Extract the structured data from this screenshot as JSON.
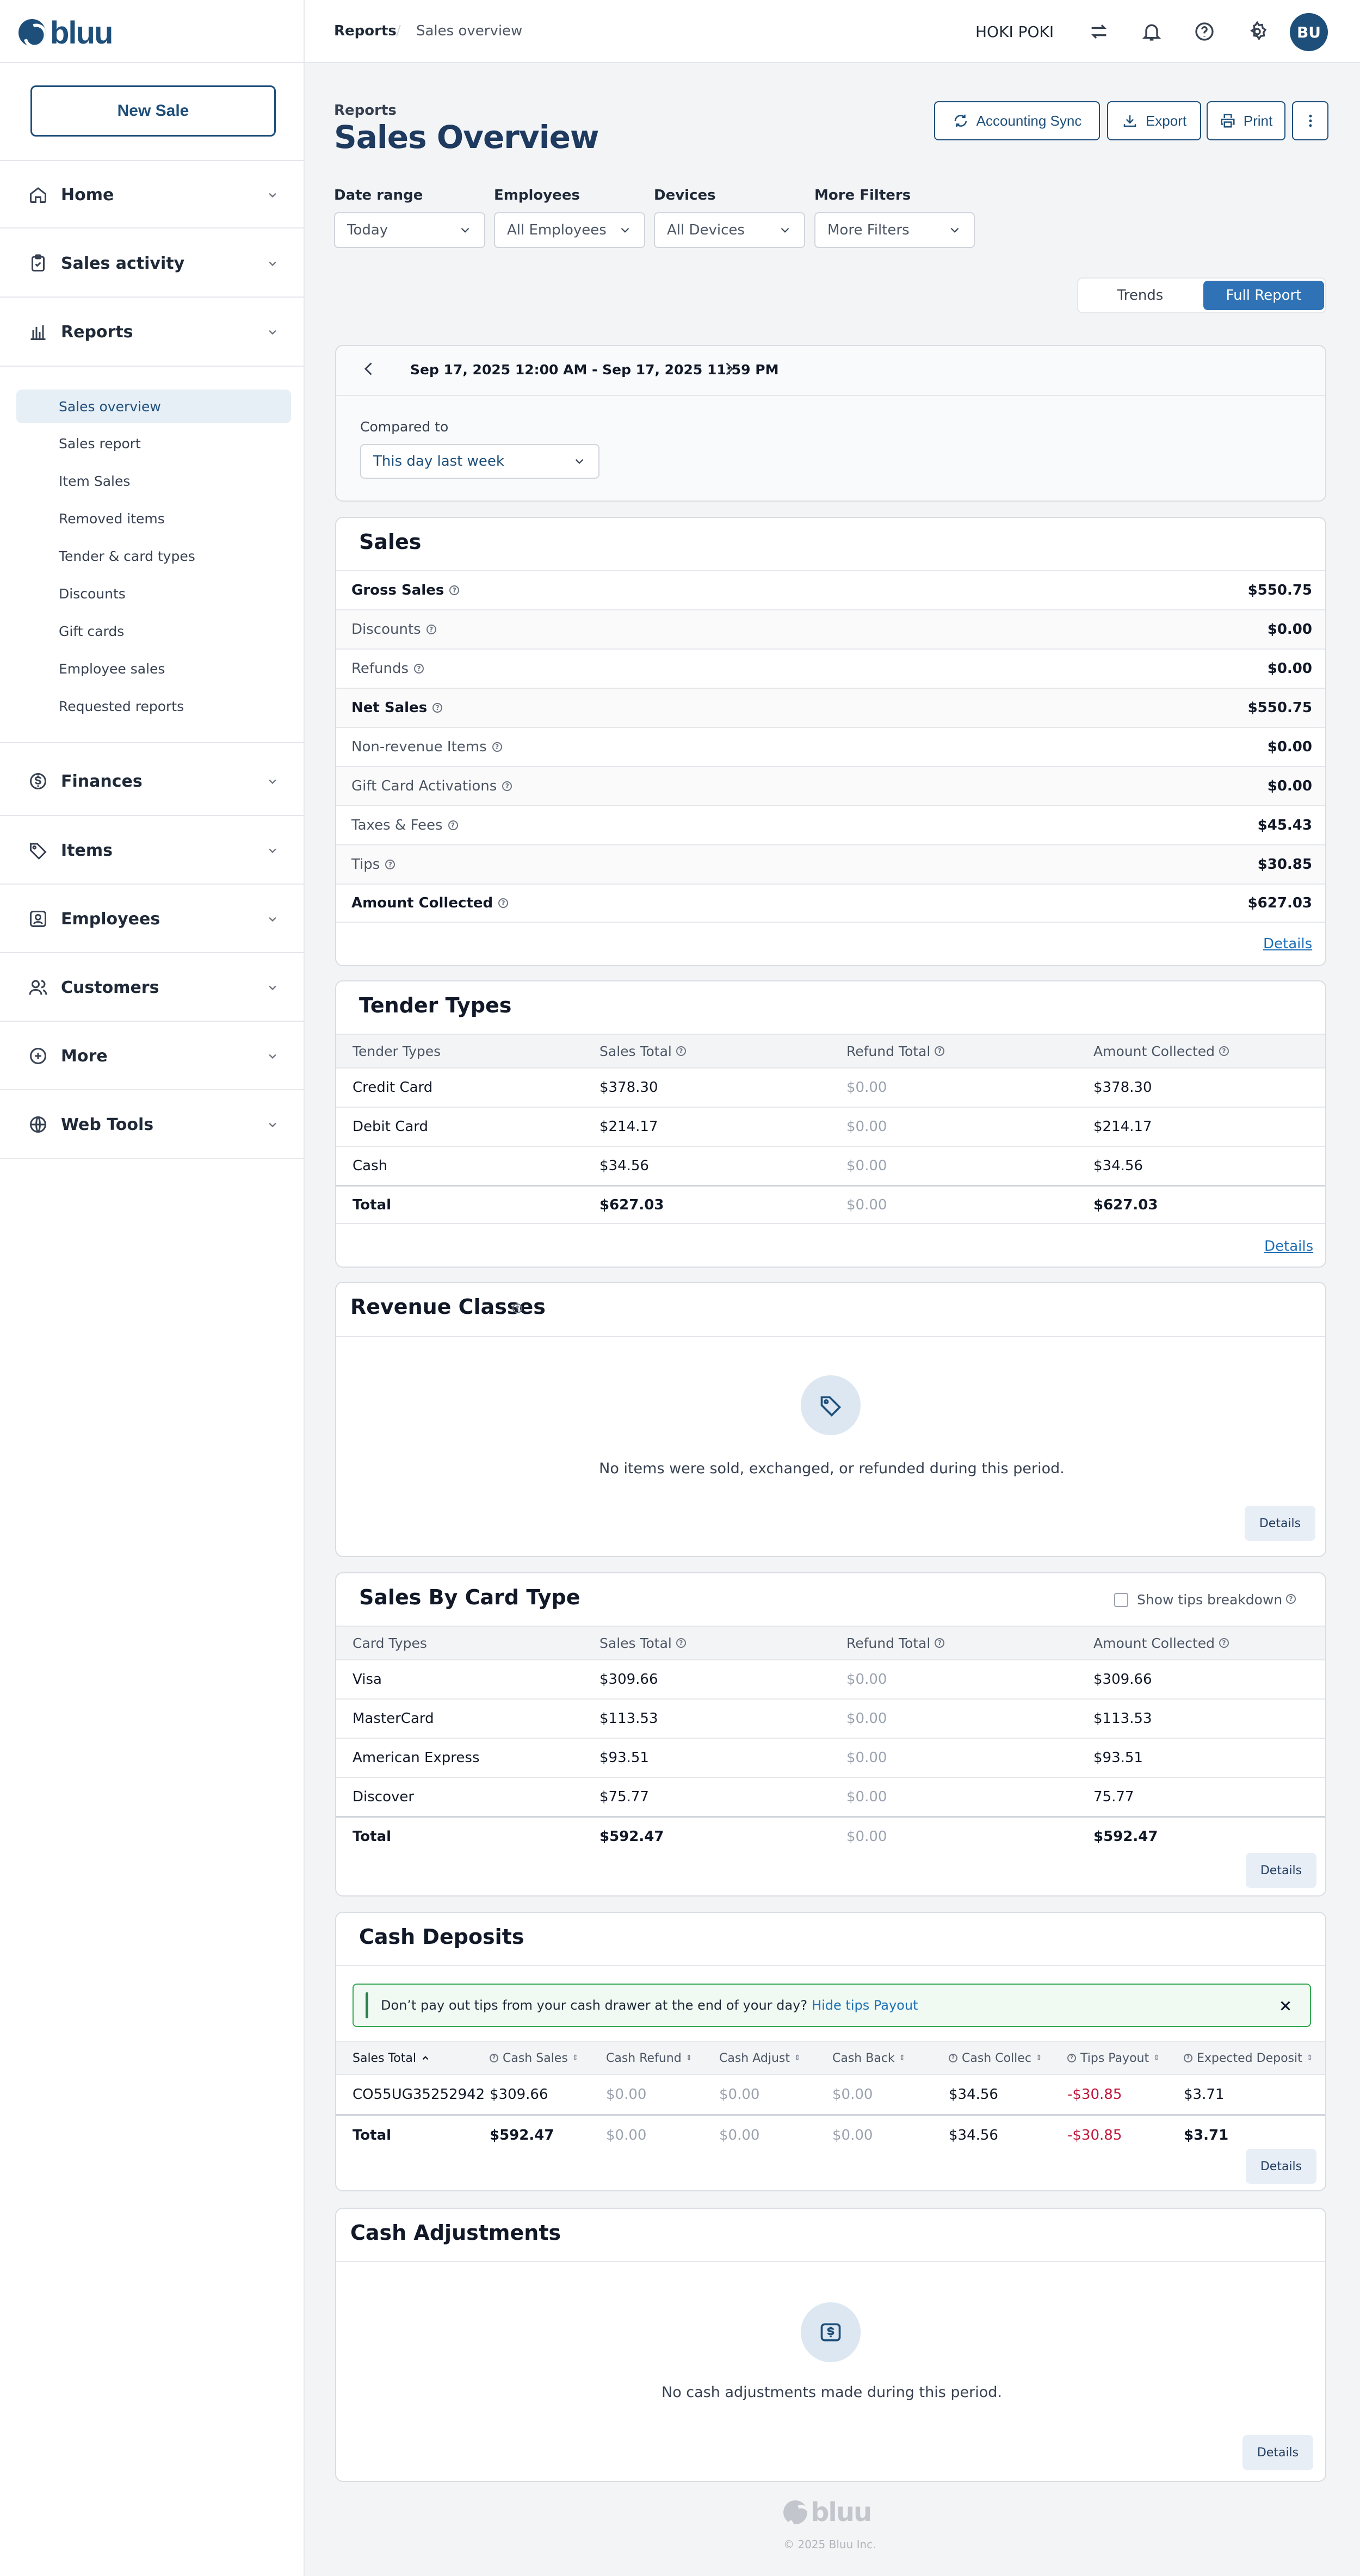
{
  "app": {
    "brand": "bluu",
    "copyright": "© 2025 Bluu Inc."
  },
  "sidebar": {
    "new_sale": "New Sale",
    "nav": [
      {
        "label": "Home",
        "icon": "home-icon"
      },
      {
        "label": "Sales activity",
        "icon": "clipboard-icon"
      },
      {
        "label": "Reports",
        "icon": "bar-chart-icon"
      },
      {
        "label": "Finances",
        "icon": "dollar-icon"
      },
      {
        "label": "Items",
        "icon": "tag-icon"
      },
      {
        "label": "Employees",
        "icon": "id-badge-icon"
      },
      {
        "label": "Customers",
        "icon": "users-icon"
      },
      {
        "label": "More",
        "icon": "plus-circle-icon"
      },
      {
        "label": "Web Tools",
        "icon": "globe-icon"
      }
    ],
    "reports_sub": [
      "Sales overview",
      "Sales report",
      "Item Sales",
      "Removed items",
      "Tender & card types",
      "Discounts",
      "Gift cards",
      "Employee sales",
      "Requested reports"
    ]
  },
  "topbar": {
    "crumb_parent": "Reports",
    "crumb_current": "Sales overview",
    "merchant": "HOKI POKI",
    "avatar": "BU"
  },
  "header": {
    "subtitle": "Reports",
    "title": "Sales Overview",
    "accounting_sync": "Accounting Sync",
    "export": "Export",
    "print": "Print"
  },
  "filters": {
    "date_range": {
      "label": "Date range",
      "value": "Today"
    },
    "employees": {
      "label": "Employees",
      "value": "All Employees"
    },
    "devices": {
      "label": "Devices",
      "value": "All Devices"
    },
    "more": {
      "label": "More Filters",
      "value": "More Filters"
    }
  },
  "view_toggle": {
    "trends": "Trends",
    "full_report": "Full Report",
    "selected": "Full Report"
  },
  "period": {
    "range": "Sep 17, 2025 12:00 AM - Sep 17, 2025 11:59 PM",
    "compared_label": "Compared to",
    "compared_value": "This day last week"
  },
  "sales": {
    "title": "Sales",
    "rows": [
      {
        "label": "Gross Sales",
        "value": "$550.75",
        "bold": true
      },
      {
        "label": "Discounts",
        "value": "$0.00",
        "bold": false
      },
      {
        "label": "Refunds",
        "value": "$0.00",
        "bold": false
      },
      {
        "label": "Net Sales",
        "value": "$550.75",
        "bold": true
      },
      {
        "label": "Non-revenue Items",
        "value": "$0.00",
        "bold": false
      },
      {
        "label": "Gift Card Activations",
        "value": "$0.00",
        "bold": false
      },
      {
        "label": "Taxes & Fees",
        "value": "$45.43",
        "bold": false
      },
      {
        "label": "Tips",
        "value": "$30.85",
        "bold": false
      },
      {
        "label": "Amount Collected",
        "value": "$627.03",
        "bold": true
      }
    ],
    "details": "Details"
  },
  "tender": {
    "title": "Tender Types",
    "headers": [
      "Tender Types",
      "Sales Total",
      "Refund Total",
      "Amount Collected"
    ],
    "rows": [
      [
        "Credit Card",
        "$378.30",
        "$0.00",
        "$378.30"
      ],
      [
        "Debit Card",
        "$214.17",
        "$0.00",
        "$214.17"
      ],
      [
        "Cash",
        "$34.56",
        "$0.00",
        "$34.56"
      ]
    ],
    "total": [
      "Total",
      "$627.03",
      "$0.00",
      "$627.03"
    ],
    "details": "Details"
  },
  "revenue": {
    "title": "Revenue Classes",
    "empty": "No items were sold, exchanged, or refunded during this period.",
    "details": "Details"
  },
  "card_types": {
    "title": "Sales By Card Type",
    "tips_breakdown": "Show tips breakdown",
    "headers": [
      "Card Types",
      "Sales Total",
      "Refund Total",
      "Amount Collected"
    ],
    "rows": [
      [
        "Visa",
        "$309.66",
        "$0.00",
        "$309.66"
      ],
      [
        "MasterCard",
        "$113.53",
        "$0.00",
        "$113.53"
      ],
      [
        "American Express",
        "$93.51",
        "$0.00",
        "$93.51"
      ],
      [
        "Discover",
        "$75.77",
        "$0.00",
        "75.77"
      ]
    ],
    "total": [
      "Total",
      "$592.47",
      "$0.00",
      "$592.47"
    ],
    "details": "Details"
  },
  "cash": {
    "title": "Cash Deposits",
    "banner_text": "Don’t pay out tips from your cash drawer at the end of your day?",
    "banner_link": "Hide tips Payout",
    "headers": [
      "Sales Total",
      "Cash Sales",
      "Cash Refund",
      "Cash Adjust",
      "Cash Back",
      "Cash Collec",
      "Tips  Payout",
      "Expected Deposit"
    ],
    "row": [
      "CO55UG35252942",
      "$309.66",
      "$0.00",
      "$0.00",
      "$0.00",
      "$34.56",
      "-$30.85",
      "$3.71"
    ],
    "total": [
      "Total",
      "$592.47",
      "$0.00",
      "$0.00",
      "$0.00",
      "$34.56",
      "-$30.85",
      "$3.71"
    ],
    "details": "Details"
  },
  "adjustments": {
    "title": "Cash Adjustments",
    "empty": "No cash adjustments made during this period.",
    "details": "Details"
  }
}
